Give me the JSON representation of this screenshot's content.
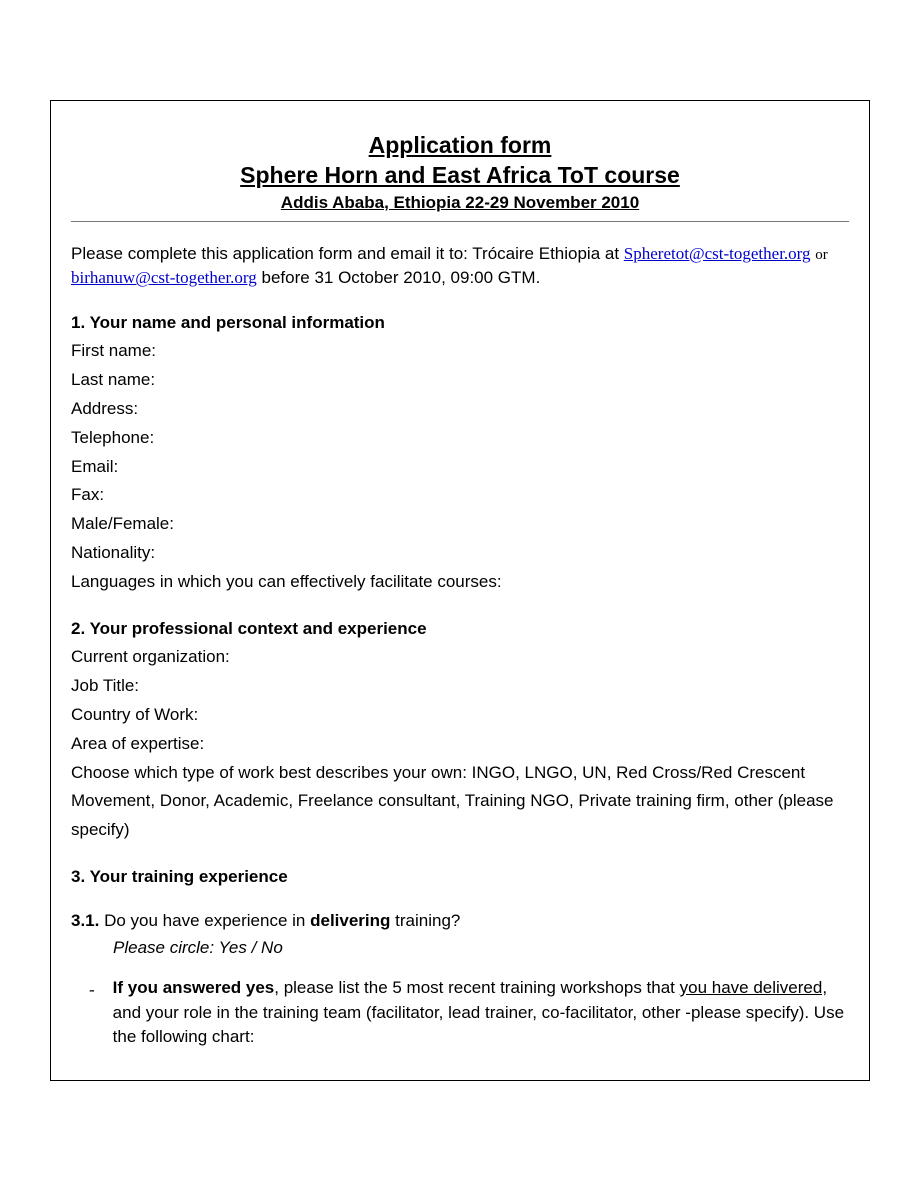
{
  "header": {
    "title1": "Application form",
    "title2": "Sphere Horn and East Africa ToT course",
    "subtitle": "Addis Ababa, Ethiopia 22-29 November 2010"
  },
  "intro": {
    "pre": "Please complete this application form and email it to: Trócaire Ethiopia at ",
    "email1": "Spheretot@cst-together.org",
    "or": "  or  ",
    "email2": "birhanuw@cst-together.org",
    "post": " before 31 October 2010, 09:00 GTM."
  },
  "section1": {
    "title": "1. Your name and personal information",
    "fields": {
      "first_name": "First name:",
      "last_name": "Last name:",
      "address": "Address:",
      "telephone": "Telephone:",
      "email": "Email:",
      "fax": "Fax:",
      "gender": "Male/Female:",
      "nationality": "Nationality:",
      "languages": "Languages in which you can effectively facilitate courses:"
    }
  },
  "section2": {
    "title": "2. Your professional context and experience",
    "fields": {
      "org": "Current organization:",
      "job": "Job Title:",
      "country": "Country of Work:",
      "expertise": "Area of expertise:",
      "worktype": "Choose which type of work best describes your own: INGO, LNGO, UN, Red Cross/Red Crescent Movement, Donor, Academic, Freelance consultant, Training NGO, Private training firm, other (please specify)"
    }
  },
  "section3": {
    "title": "3. Your training experience",
    "q31_prefix": "3.1.",
    "q31_mid1": " Do you have experience in ",
    "q31_bold": "delivering",
    "q31_mid2": " training?",
    "q31_instruction": "Please circle: Yes / No",
    "bullet_dash": "-",
    "bullet_bold": "If you answered yes",
    "bullet_mid1": ", please list the 5 most recent training workshops that ",
    "bullet_underline": "you have delivered,",
    "bullet_mid2": " and your role in the training team (facilitator, lead trainer, co-facilitator, other -please specify). Use the following chart:"
  }
}
